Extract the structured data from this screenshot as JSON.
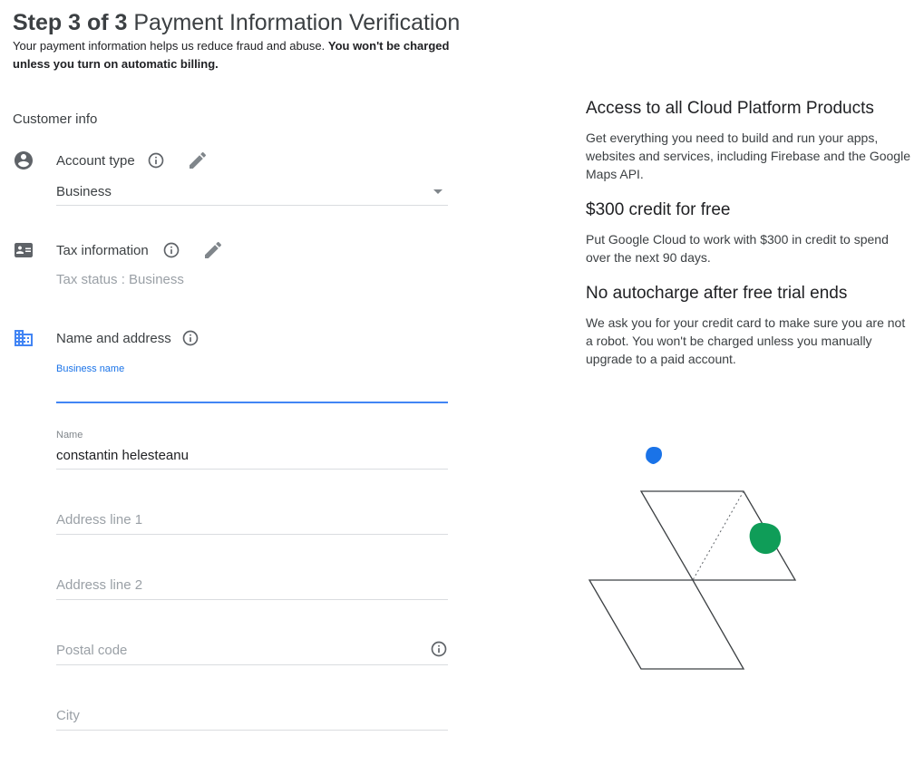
{
  "header": {
    "step": "Step 3 of 3",
    "title": "Payment Information Verification",
    "subtitle_normal": "Your payment information helps us reduce fraud and abuse.",
    "subtitle_bold": "You won't be charged unless you turn on automatic billing."
  },
  "customer_info": {
    "section_title": "Customer info",
    "account_type": {
      "label": "Account type",
      "value": "Business"
    },
    "tax_information": {
      "label": "Tax information",
      "status": "Tax status : Business"
    },
    "name_and_address": {
      "label": "Name and address",
      "business_name_label": "Business name",
      "business_name_value": "",
      "name_label": "Name",
      "name_value": "constantin helesteanu",
      "address1_placeholder": "Address line 1",
      "address2_placeholder": "Address line 2",
      "postal_placeholder": "Postal code",
      "city_placeholder": "City"
    }
  },
  "benefits": [
    {
      "heading": "Access to all Cloud Platform Products",
      "text": "Get everything you need to build and run your apps, websites and services, including Firebase and the Google Maps API."
    },
    {
      "heading": "$300 credit for free",
      "text": "Put Google Cloud to work with $300 in credit to spend over the next 90 days."
    },
    {
      "heading": "No autocharge after free trial ends",
      "text": "We ask you for your credit card to make sure you are not a robot. You won't be charged unless you manually upgrade to a paid account."
    }
  ],
  "icons": {
    "account": "account-circle-icon",
    "tax": "id-card-icon",
    "address": "business-icon",
    "info": "info-icon",
    "edit": "pencil-icon"
  },
  "colors": {
    "accent_blue": "#4285f4",
    "link_blue": "#1a73e8",
    "green": "#0f9d58",
    "divider": "#dadce0"
  }
}
